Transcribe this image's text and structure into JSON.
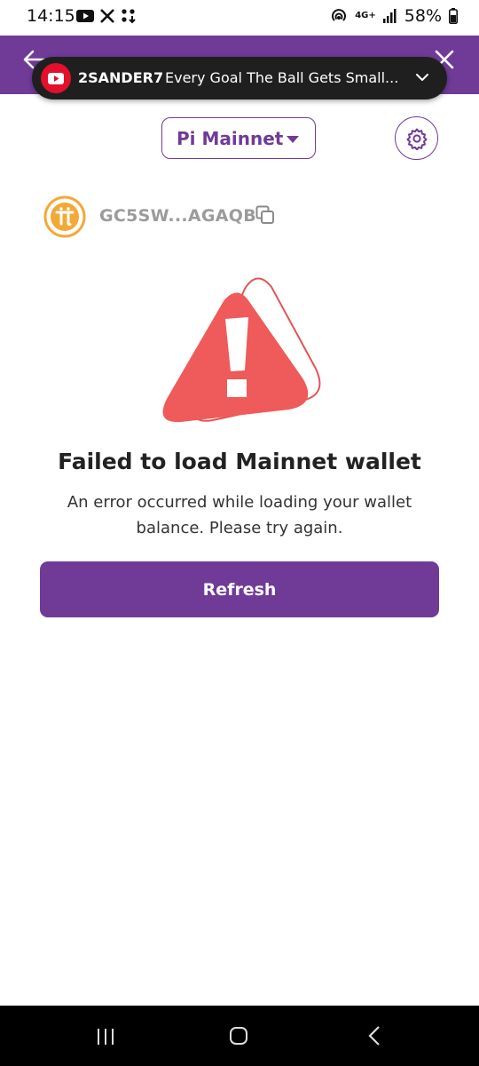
{
  "status_bar": {
    "time": "14:15",
    "network": "4G+",
    "battery": "58%",
    "icons": [
      "youtube-icon",
      "x-icon",
      "grid-icon",
      "hotspot-icon",
      "signal-icon",
      "battery-icon"
    ]
  },
  "notification": {
    "channel": "2SANDER7",
    "title": "Every Goal The Ball Gets Small..."
  },
  "network_selector": {
    "label": "Pi Mainnet"
  },
  "wallet": {
    "address": "GC5SW...AGAQB"
  },
  "error": {
    "title": "Failed to load Mainnet wallet",
    "message": "An error occurred while loading your wallet balance. Please try again."
  },
  "actions": {
    "refresh_label": "Refresh"
  },
  "colors": {
    "brand_purple": "#6f3b97",
    "warning_red": "#ef5a5a",
    "pi_gold": "#f3a937",
    "youtube_red": "#e2102a"
  }
}
